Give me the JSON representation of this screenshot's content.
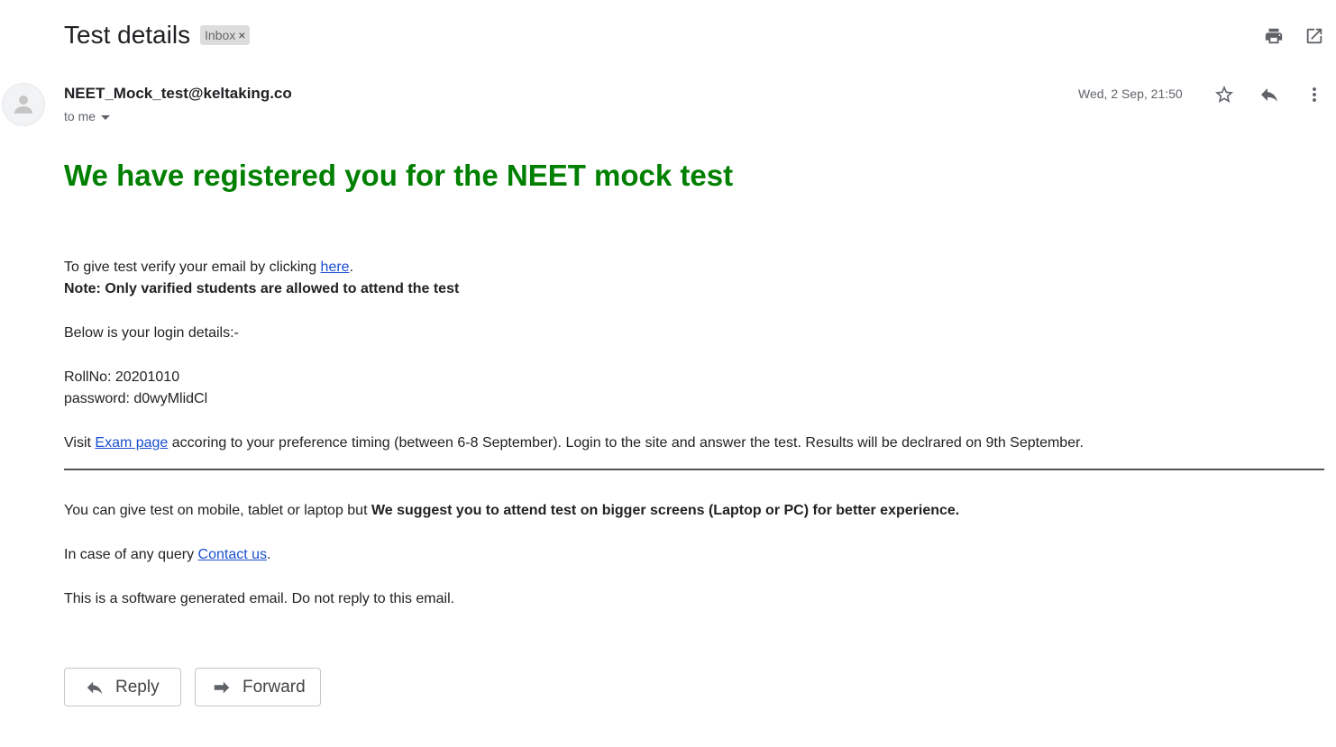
{
  "header": {
    "subject": "Test details",
    "label_chip": "Inbox",
    "label_remove": "×"
  },
  "message": {
    "sender": "NEET_Mock_test@keltaking.co",
    "recipient": "to me",
    "date": "Wed, 2 Sep, 21:50"
  },
  "body": {
    "headline": "We have registered you for the NEET mock test",
    "verify_prefix": "To give test verify your email by clicking ",
    "verify_link": "here",
    "verify_suffix": ".",
    "note": "Note: Only varified students are allowed to attend the test",
    "login_intro": "Below is your login details:-",
    "rollno": "RollNo: 20201010",
    "password": "password: d0wyMlidCl",
    "visit_prefix": "Visit ",
    "exam_link": "Exam page",
    "visit_suffix": " accoring to your preference timing (between 6-8 September). Login to the site and answer the test. Results will be declrared on 9th September.",
    "devices_prefix": "You can give test on mobile, tablet or laptop but ",
    "devices_bold": "We suggest you to attend test on bigger screens (Laptop or PC) for better experience.",
    "query_prefix": "In case of any query ",
    "contact_link": "Contact us",
    "query_suffix": ".",
    "auto_note": "This is a software generated email. Do not reply to this email."
  },
  "actions": {
    "reply_label": "Reply",
    "forward_label": "Forward"
  },
  "icons": {
    "print": "print-icon",
    "open_new_window": "open-in-new-window-icon",
    "star": "star-icon",
    "reply": "reply-icon",
    "more": "more-vertical-icon",
    "avatar": "person-icon",
    "forward": "forward-icon"
  },
  "colors": {
    "headline": "#008000",
    "link": "#1a4fd0",
    "chip_bg": "#dddddd"
  }
}
